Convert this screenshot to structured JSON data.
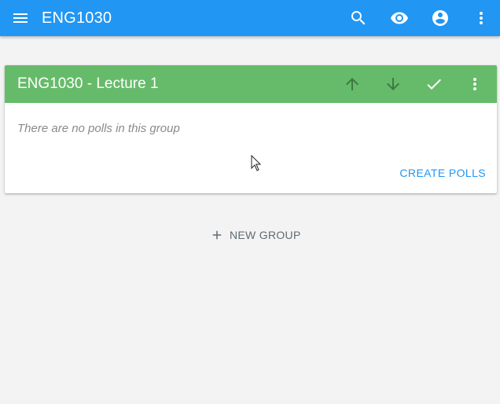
{
  "appbar": {
    "title": "ENG1030",
    "icons": [
      "menu-icon",
      "search-icon",
      "eye-icon",
      "account-circle-icon",
      "more-vert-icon"
    ],
    "color": "#2196f3"
  },
  "group": {
    "title": "ENG1030 - Lecture 1",
    "header_color": "#66bb6a",
    "icons": [
      "arrow-up-icon",
      "arrow-down-icon",
      "check-icon",
      "more-vert-icon"
    ],
    "empty_message": "There are no polls in this group",
    "create_label": "CREATE POLLS"
  },
  "new_group_label": "NEW GROUP",
  "accent_color": "#2196f3"
}
